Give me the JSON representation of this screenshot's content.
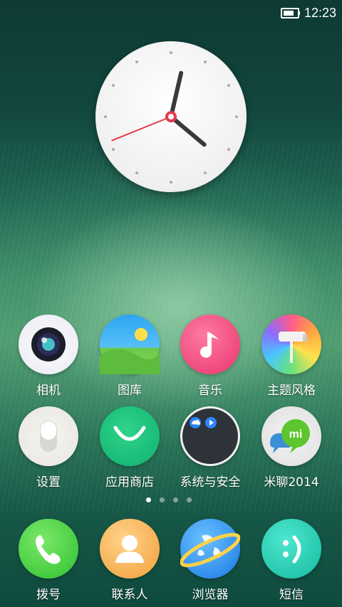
{
  "status": {
    "time": "12:23",
    "battery_icon": "battery-icon"
  },
  "apps_row1": [
    {
      "label": "相机",
      "icon": "camera-icon"
    },
    {
      "label": "图库",
      "icon": "gallery-icon"
    },
    {
      "label": "音乐",
      "icon": "music-icon"
    },
    {
      "label": "主题风格",
      "icon": "theme-icon"
    }
  ],
  "apps_row2": [
    {
      "label": "设置",
      "icon": "settings-icon"
    },
    {
      "label": "应用商店",
      "icon": "app-store-icon"
    },
    {
      "label": "系统与安全",
      "icon": "folder-icon"
    },
    {
      "label": "米聊2014",
      "icon": "miliao-icon"
    }
  ],
  "dock": [
    {
      "label": "拨号",
      "icon": "phone-icon"
    },
    {
      "label": "联系人",
      "icon": "contacts-icon"
    },
    {
      "label": "浏览器",
      "icon": "browser-icon"
    },
    {
      "label": "短信",
      "icon": "messages-icon"
    }
  ],
  "pages": {
    "count": 4,
    "active_index": 0
  },
  "widget": {
    "clock_hour": 12,
    "clock_minute": 23
  }
}
